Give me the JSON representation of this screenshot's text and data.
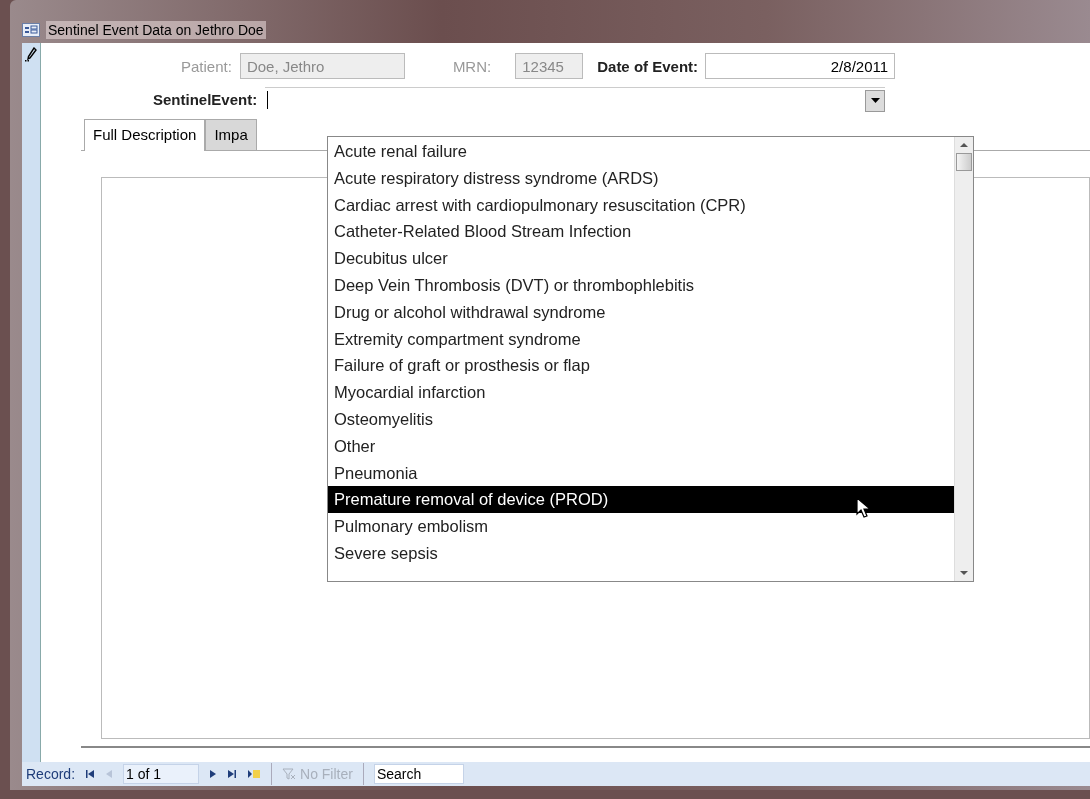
{
  "window": {
    "title": "Sentinel Event Data on Jethro Doe"
  },
  "patient": {
    "label": "Patient:",
    "value": "Doe, Jethro",
    "disabled": true
  },
  "mrn": {
    "label": "MRN:",
    "value": "12345",
    "disabled": true
  },
  "date_of_event": {
    "label": "Date of Event:",
    "value": "2/8/2011"
  },
  "sentinel_event": {
    "label": "SentinelEvent:",
    "expanded": true
  },
  "tabs": [
    {
      "label": "Full Description",
      "selected": true
    },
    {
      "label": "Impa",
      "selected": false
    }
  ],
  "dropdown_options": [
    {
      "label": "Acute renal failure",
      "selected": false
    },
    {
      "label": "Acute respiratory distress syndrome (ARDS)",
      "selected": false
    },
    {
      "label": "Cardiac arrest with cardiopulmonary resuscitation (CPR)",
      "selected": false
    },
    {
      "label": "Catheter-Related Blood Stream Infection",
      "selected": false
    },
    {
      "label": "Decubitus ulcer",
      "selected": false
    },
    {
      "label": "Deep Vein Thrombosis (DVT) or  thrombophlebitis",
      "selected": false
    },
    {
      "label": "Drug or alcohol withdrawal syndrome",
      "selected": false
    },
    {
      "label": "Extremity compartment syndrome",
      "selected": false
    },
    {
      "label": "Failure of graft or prosthesis or flap",
      "selected": false
    },
    {
      "label": "Myocardial infarction",
      "selected": false
    },
    {
      "label": "Osteomyelitis",
      "selected": false
    },
    {
      "label": "Other",
      "selected": false
    },
    {
      "label": "Pneumonia",
      "selected": false
    },
    {
      "label": "Premature removal of device (PROD)",
      "selected": true
    },
    {
      "label": "Pulmonary embolism",
      "selected": false
    },
    {
      "label": "Severe sepsis",
      "selected": false
    }
  ],
  "navigation": {
    "label": "Record:",
    "position": "1 of 1",
    "filter": {
      "label": "No Filter",
      "disabled": true
    },
    "search": {
      "placeholder": "Search"
    }
  }
}
